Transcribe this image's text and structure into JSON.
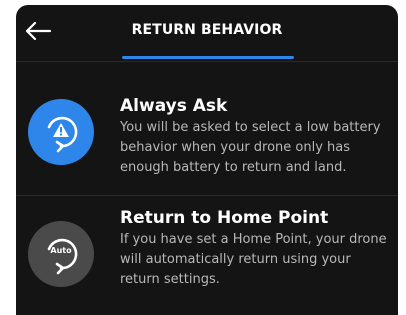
{
  "header": {
    "title": "RETURN BEHAVIOR",
    "back_icon": "arrow-left-icon"
  },
  "options": [
    {
      "title": "Always Ask",
      "description": "You will be asked to select a low battery behavior when your drone only has enough battery to return and land.",
      "icon": "warning-return-icon",
      "selected": true
    },
    {
      "title": "Return to Home Point",
      "description": "If you have set a Home Point, your drone will automatically return using your return settings.",
      "icon": "auto-return-icon",
      "icon_text": "Auto",
      "selected": false
    }
  ],
  "colors": {
    "accent": "#2f86ea",
    "background": "#141414",
    "icon_inactive": "#4a4a4a"
  }
}
